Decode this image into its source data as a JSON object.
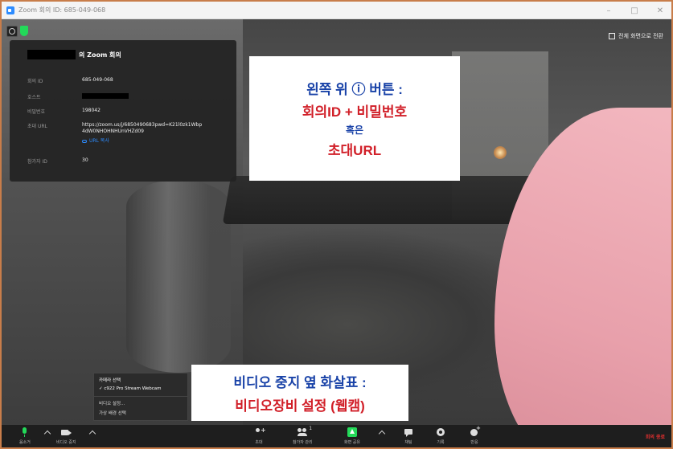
{
  "window": {
    "title": "Zoom 회의 ID: 685-049-068",
    "controls": [
      "–",
      "□",
      "✕"
    ]
  },
  "fullscreen_label": "전체 화면으로 전환",
  "info_panel": {
    "title_suffix": "의 Zoom 회의",
    "rows": [
      {
        "key": "회의 ID",
        "value": "685-049-068"
      },
      {
        "key": "호스트",
        "value": ""
      },
      {
        "key": "비밀번호",
        "value": "198042"
      },
      {
        "key": "초대 URL",
        "value": "https://zoom.us/j/6850490683pwd=K21l0zk1Wbp4dW0NHOHNHUnVHZd09"
      },
      {
        "key": "참가자 ID",
        "value": "30"
      }
    ],
    "copy_url_label": "URL 복사"
  },
  "callout_top": {
    "line1": "왼쪽 위 ⓘ 버튼 :",
    "line2": "회의ID + 비밀번호",
    "line3": "혹은",
    "line4": "초대URL"
  },
  "callout_bottom": {
    "line1": "비디오 중지 옆 화살표 :",
    "line2": "비디오장비 설정 (웹캠)"
  },
  "camera_menu": {
    "header": "카메라 선택",
    "selected": "✓ c922 Pro Stream Webcam",
    "item2": "비디오 설정...",
    "item3": "가상 배경 선택"
  },
  "toolbar": {
    "mute": "음소거",
    "stop_video": "비디오 중지",
    "invite": "초대",
    "participants": "참가자 관리",
    "participant_count": "1",
    "share_screen": "화면 공유",
    "chat": "채팅",
    "record": "기록",
    "reactions": "반응",
    "end": "회의 종료"
  },
  "colors": {
    "accent_green": "#23d959",
    "zoom_blue": "#2d8cff",
    "callout_blue": "#1a43a8",
    "callout_red": "#d11f28",
    "end_red": "#e02f2f"
  }
}
